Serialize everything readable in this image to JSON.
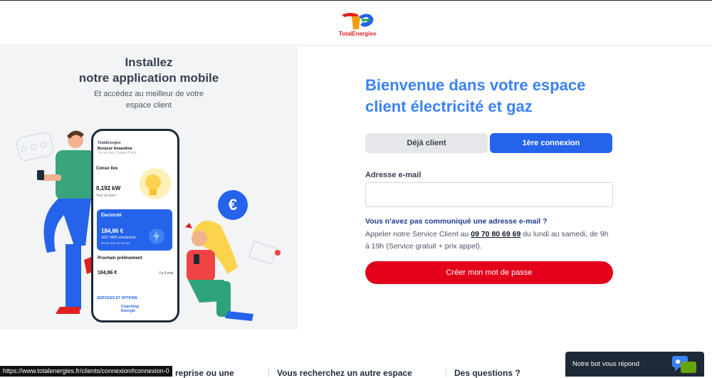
{
  "header": {
    "brand": "TotalEnergies"
  },
  "promo": {
    "title_line1": "Installez",
    "title_line2": "notre application mobile",
    "subtitle_line1": "Et accédez au meilleur de votre",
    "subtitle_line2": "espace client"
  },
  "app_mockup": {
    "brand": "TotalEnergies",
    "greeting": "Bonjour Amandine",
    "address": "14 rue des 2 gares Paris",
    "conso_label": "Conso live",
    "conso_value": "0,192 kW",
    "conso_note": "Tout va bien !",
    "electricity_label": "Électricité",
    "electricity_amount": "184,86 €",
    "electricity_kwh": "1017 kWh consommé",
    "electricity_period": "du 15 mar au 15 avr",
    "prelevement_label": "Prochain prélèvement",
    "prelevement_amount": "184,86 €",
    "prelevement_date": "Le 6 mai",
    "services_label": "SERVICES ET OPTIONS",
    "coaching_label": "Coaching Energie",
    "euro_symbol": "€"
  },
  "login": {
    "welcome_line1": "Bienvenue dans votre espace",
    "welcome_line2": "client électricité et gaz",
    "tab_existing": "Déjà client",
    "tab_first": "1ère connexion",
    "email_label": "Adresse e-mail",
    "email_value": "",
    "no_email_question": "Vous n'avez pas communiqué une adresse e-mail ?",
    "service_prefix": "Appeler notre Service Client au ",
    "service_phone": "09 70 80 69 69",
    "service_suffix": " du lundi au samedi, de 9h à 19h (Service gratuit + prix appel).",
    "create_button": "Créer mon mot de passe"
  },
  "footer": {
    "link1": "reprise ou une",
    "link2": "Vous recherchez un autre espace",
    "link3": "Des questions ?"
  },
  "status_bar": {
    "url": "https://www.totalenergies.fr/clients/connexion#connexion-0"
  },
  "chatbot": {
    "label": "Notre bot vous répond"
  },
  "colors": {
    "accent_blue": "#2563eb",
    "brand_red": "#e2001a",
    "title_blue": "#3b82f6"
  }
}
